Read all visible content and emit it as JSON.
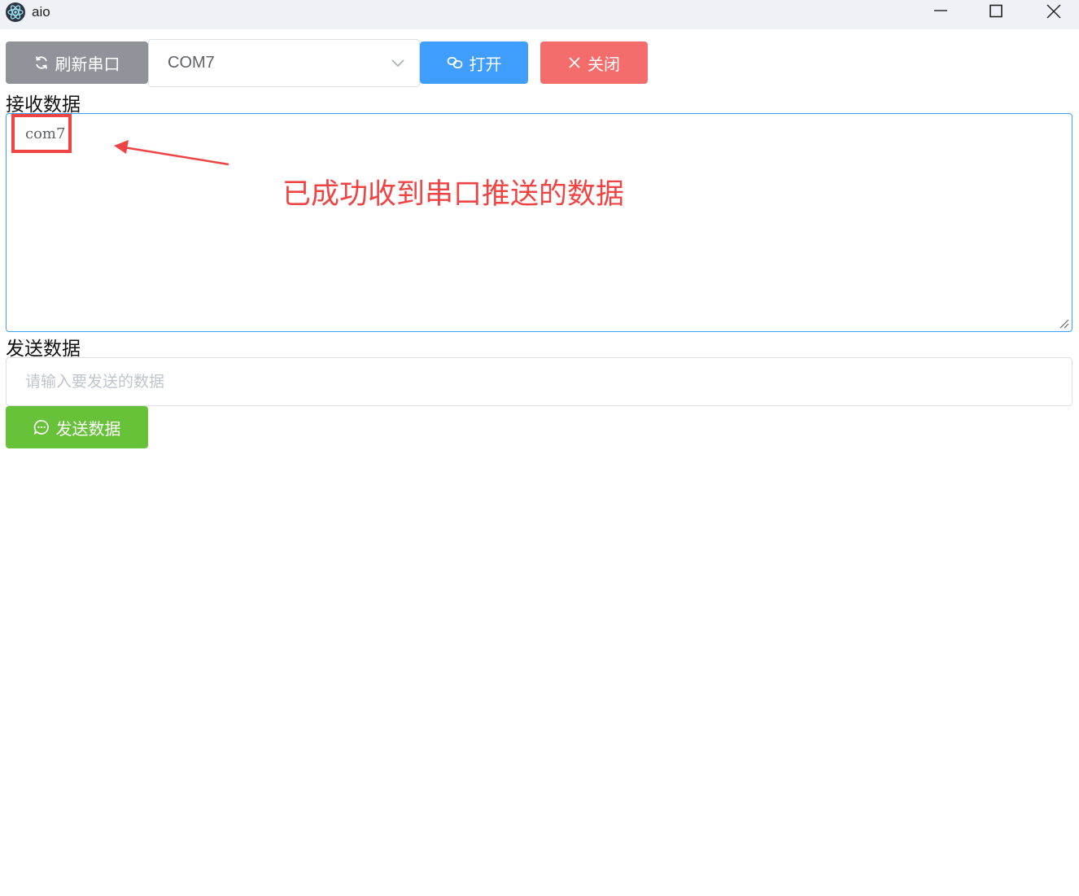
{
  "window": {
    "title": "aio",
    "icons": [
      "electron-logo-icon",
      "minimize-icon",
      "maximize-icon",
      "close-window-icon"
    ]
  },
  "toolbar": {
    "refresh_label": "刷新串口",
    "port_selected": "COM7",
    "open_label": "打开",
    "close_label": "关闭",
    "icons": [
      "refresh-icon",
      "chevron-down-icon",
      "link-icon",
      "x-icon"
    ],
    "colors": {
      "refresh": "#909399",
      "open": "#409eff",
      "close": "#f56c6c"
    }
  },
  "receive": {
    "label": "接收数据",
    "content": "com7"
  },
  "send": {
    "label": "发送数据",
    "placeholder": "请输入要发送的数据",
    "value": "",
    "button_label": "发送数据",
    "button_icon": "chat-bubble-icon",
    "button_color": "#67c23a"
  },
  "annotation": {
    "text": "已成功收到串口推送的数据",
    "color": "#ef4444"
  }
}
